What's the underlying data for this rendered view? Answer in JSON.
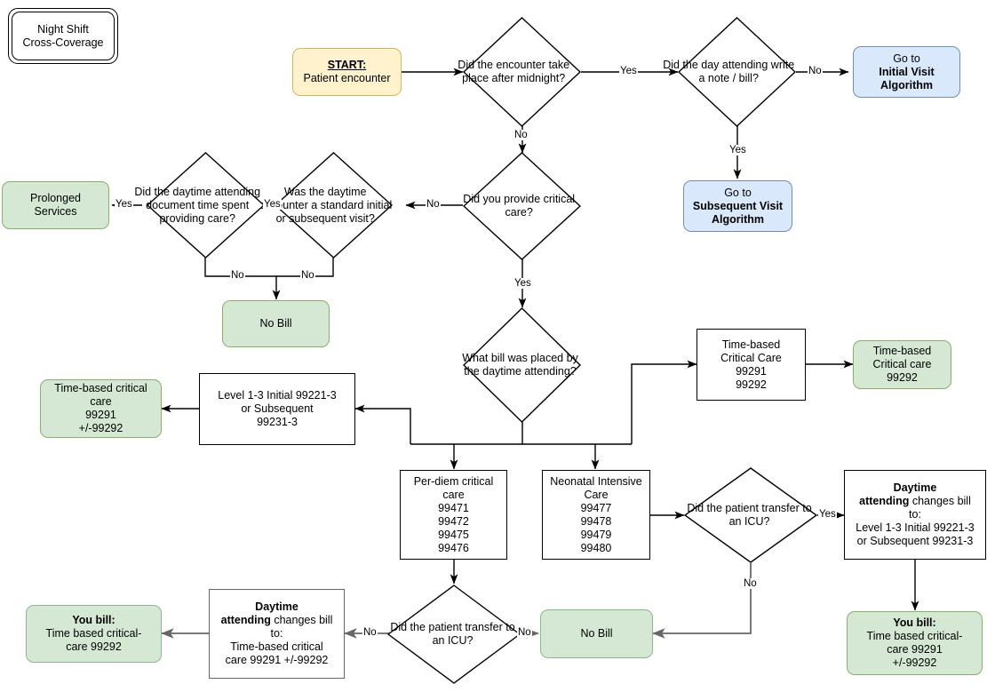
{
  "diagram": {
    "title": "Night Shift Cross-Coverage",
    "type": "flowchart",
    "colors": {
      "start_fill": "#fff2cc",
      "start_stroke": "#d6b656",
      "terminal_fill": "#d5e8d4",
      "terminal_stroke": "#82b366",
      "reference_fill": "#dae8fc",
      "reference_stroke": "#6c8ebf",
      "process_fill": "#ffffff",
      "process_stroke": "#000000"
    }
  },
  "nodes": {
    "title_box": {
      "line1": "Night Shift",
      "line2": "Cross-Coverage"
    },
    "start": {
      "label": "START:",
      "sublabel": "Patient encounter"
    },
    "d_after_midnight": {
      "text": "Did the encounter take place after midnight?"
    },
    "d_day_attending_note": {
      "text": "Did the day attending write a note / bill?"
    },
    "go_initial_visit": {
      "line1": "Go to",
      "line2": "Initial Visit",
      "line3": "Algorithm"
    },
    "go_subsequent_visit": {
      "line1": "Go to",
      "line2": "Subsequent Visit",
      "line3": "Algorithm"
    },
    "d_critical_care": {
      "text": "Did you provide critical care?"
    },
    "d_standard_visit": {
      "text": "Was the daytime encounter a standard initial or subsequent visit?"
    },
    "d_document_time": {
      "text": "Did the daytime attending document time spent providing care?"
    },
    "prolonged_services": {
      "line1": "Prolonged",
      "line2": "Services"
    },
    "no_bill_top": {
      "line1": "No Bill"
    },
    "d_what_bill": {
      "text": "What bill was placed by the daytime attending?"
    },
    "tbcc_process": {
      "line1": "Time-based",
      "line2": "Critical Care",
      "line3": "99291",
      "line4": "99292"
    },
    "tbcc_terminal": {
      "line1": "Time-based",
      "line2": "Critical care",
      "line3": "99292"
    },
    "level13_process": {
      "line1": "Level 1-3 Initial 99221-3",
      "line2": "or Subsequent",
      "line3": "99231-3"
    },
    "tbcc_left_terminal": {
      "line1": "Time-based critical",
      "line2": "care",
      "line3": "99291",
      "line4": "+/-99292"
    },
    "per_diem": {
      "line1": "Per-diem critical",
      "line2": "care",
      "line3": "99471",
      "line4": "99472",
      "line5": "99475",
      "line6": "99476"
    },
    "neonatal": {
      "line1": "Neonatal Intensive",
      "line2": "Care",
      "line3": "99477",
      "line4": "99478",
      "line5": "99479",
      "line6": "99480"
    },
    "d_icu_transfer_right": {
      "text": "Did the patient transfer to an ICU?"
    },
    "d_icu_transfer_bottom": {
      "text": "Did the patient transfer to an ICU?"
    },
    "daytime_changes_level": {
      "line1": "Daytime",
      "line2": "attending",
      "line2b": " changes bill",
      "line3": "to:",
      "line4": "Level 1-3 Initial 99221-3",
      "line5": "or Subsequent 99231-3"
    },
    "daytime_changes_tbcc": {
      "line1": "Daytime",
      "line2": "attending",
      "line2b": " changes bill",
      "line3": "to:",
      "line4": "Time-based critical",
      "line5": "care 99291 +/-99292"
    },
    "you_bill_99292": {
      "line1": "You bill:",
      "line2": "Time based critical-",
      "line3": "care 99292"
    },
    "you_bill_99291": {
      "line1": "You bill:",
      "line2": "Time based critical-",
      "line3": "care 99291",
      "line4": "+/-99292"
    },
    "no_bill_bottom": {
      "line1": "No Bill"
    }
  },
  "edge_labels": {
    "yes_1": "Yes",
    "no_1": "No",
    "no_2": "No",
    "yes_2": "Yes",
    "no_3": "No",
    "yes_3": "Yes",
    "yes_4": "Yes",
    "no_4": "No",
    "no_5": "No",
    "yes_5": "Yes",
    "yes_6": "Yes",
    "no_6": "No",
    "no_7": "No",
    "no_8": "No"
  }
}
